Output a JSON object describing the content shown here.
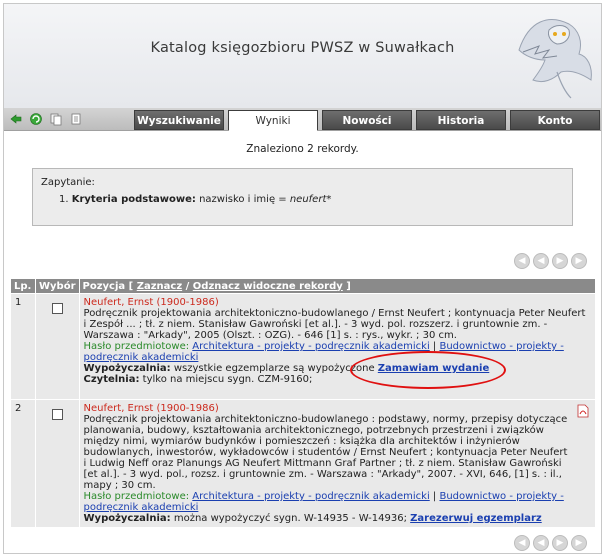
{
  "header": {
    "title": "Katalog księgozbioru PWSZ w Suwałkach"
  },
  "toolbar": {
    "icons": [
      "exit-icon",
      "refresh-icon",
      "copy-icon",
      "pages-icon"
    ],
    "tabs": [
      {
        "label": "Wyszukiwanie",
        "active": false
      },
      {
        "label": "Wyniki",
        "active": true
      },
      {
        "label": "Nowości",
        "active": false
      },
      {
        "label": "Historia",
        "active": false
      },
      {
        "label": "Konto",
        "active": false
      }
    ]
  },
  "results": {
    "found_text": "Znaleziono 2 rekordy.",
    "query_label": "Zapytanie:",
    "query_number": "1.",
    "query_key": "Kryteria podstawowe:",
    "query_text": " nazwisko i imię = ",
    "query_value": "neufert*",
    "columns": {
      "lp": "Lp.",
      "wybor": "Wybór",
      "pozycja": "Pozycja",
      "zaznacz": "Zaznacz",
      "odznacz": "Odznacz widoczne rekordy"
    },
    "records": [
      {
        "lp": "1",
        "author": "Neufert, Ernst (1900-1986)",
        "description": "Podręcznik projektowania architektoniczno-budowlanego / Ernst Neufert ; kontynuacja Peter Neufert i Zespół ... ; tł. z niem. Stanisław Gawroński [et al.]. - 3 wyd. pol. rozszerz. i gruntownie zm. - Warszawa : \"Arkady\", 2005 (Olszt. : OZG). - 646 [1] s. : rys., wykr. ; 30 cm.",
        "subject_label": "Hasło przedmiotowe:",
        "subject_1": "Architektura - projekty - podręcznik akademicki",
        "subject_2": "Budownictwo - projekty - podręcznik akademicki",
        "loan_label": "Wypożyczalnia:",
        "loan_text": " wszystkie egzemplarze są wypożyczone ",
        "loan_link": "Zamawiam wydanie",
        "reading_label": "Czytelnia:",
        "reading_text": " tylko na miejscu sygn. CZM-9160;"
      },
      {
        "lp": "2",
        "author": "Neufert, Ernst (1900-1986)",
        "description": "Podręcznik projektowania architektoniczno-budowlanego : podstawy, normy, przepisy dotyczące planowania, budowy, kształtowania architektonicznego, potrzebnych przestrzeni i związków między nimi, wymiarów budynków i pomieszczeń : książka dla architektów i inżynierów budowlanych, inwestorów, wykładowców i studentów / Ernst Neufert ; kontynuacja Peter Neufert i Ludwig Neff oraz Planungs AG Neufert Mittmann Graf Partner ; tł. z niem. Stanisław Gawroński [et al.]. - 3 wyd. pol., rozsz. i gruntownie zm. - Warszawa : \"Arkady\", 2007. - XVI, 646, [1] s. : il., mapy ; 30 cm.",
        "subject_label": "Hasło przedmiotowe:",
        "subject_1": "Architektura - projekty - podręcznik akademicki",
        "subject_2": "Budownictwo - projekty - podręcznik akademicki",
        "loan_label": "Wypożyczalnia:",
        "loan_text": " można wypożyczyć sygn. W-14935 - W-14936; ",
        "loan_link": "Zarezerwuj egzemplarz"
      }
    ]
  },
  "colors": {
    "tab_dark": "#4a4a4a",
    "author": "#cc2a1e",
    "subject": "#2a8a2a",
    "link": "#1a3fb0",
    "highlight": "#e01010"
  }
}
